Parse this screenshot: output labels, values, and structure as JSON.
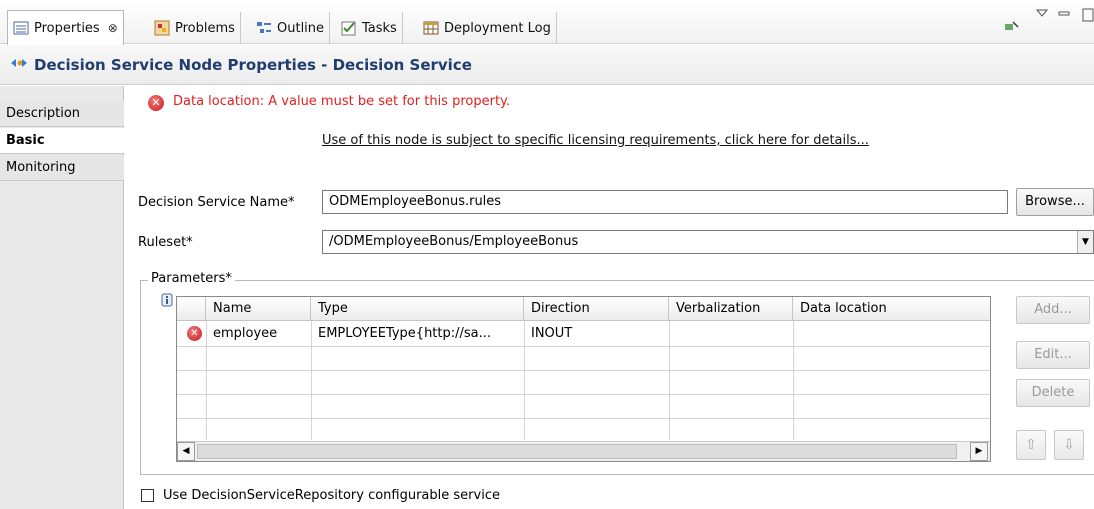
{
  "tabs": [
    {
      "label": "Properties",
      "icon": "properties-icon",
      "active": true,
      "close": "⊗"
    },
    {
      "label": "Problems",
      "icon": "problems-icon"
    },
    {
      "label": "Outline",
      "icon": "outline-icon"
    },
    {
      "label": "Tasks",
      "icon": "tasks-icon"
    },
    {
      "label": "Deployment Log",
      "icon": "deployment-log-icon"
    }
  ],
  "header": {
    "title": "Decision Service Node Properties - Decision Service",
    "icon": "node-icon"
  },
  "sidebar": {
    "items": [
      {
        "label": "Description"
      },
      {
        "label": "Basic",
        "active": true
      },
      {
        "label": "Monitoring"
      }
    ]
  },
  "error_message": "Data location: A value must be set for this property.",
  "license_link": "Use of this node is subject to specific licensing requirements, click here for details...",
  "form": {
    "decision_service_name_label": "Decision Service Name*",
    "decision_service_name_value": "ODMEmployeeBonus.rules",
    "browse_label": "Browse...",
    "ruleset_label": "Ruleset*",
    "ruleset_value": "/ODMEmployeeBonus/EmployeeBonus"
  },
  "parameters": {
    "legend": "Parameters*",
    "columns": [
      "Name",
      "Type",
      "Direction",
      "Verbalization",
      "Data location"
    ],
    "rows": [
      {
        "name": "employee",
        "type": "EMPLOYEEType{http://sa...",
        "direction": "INOUT",
        "verbalization": "",
        "data_location": "",
        "error": true
      }
    ],
    "buttons": {
      "add": "Add...",
      "edit": "Edit...",
      "delete": "Delete"
    }
  },
  "checkbox_label": "Use DecisionServiceRepository configurable service",
  "colors": {
    "error": "#e0201f",
    "header_title": "#1f3d6e",
    "sidebar_bg": "#e9e9e9"
  }
}
